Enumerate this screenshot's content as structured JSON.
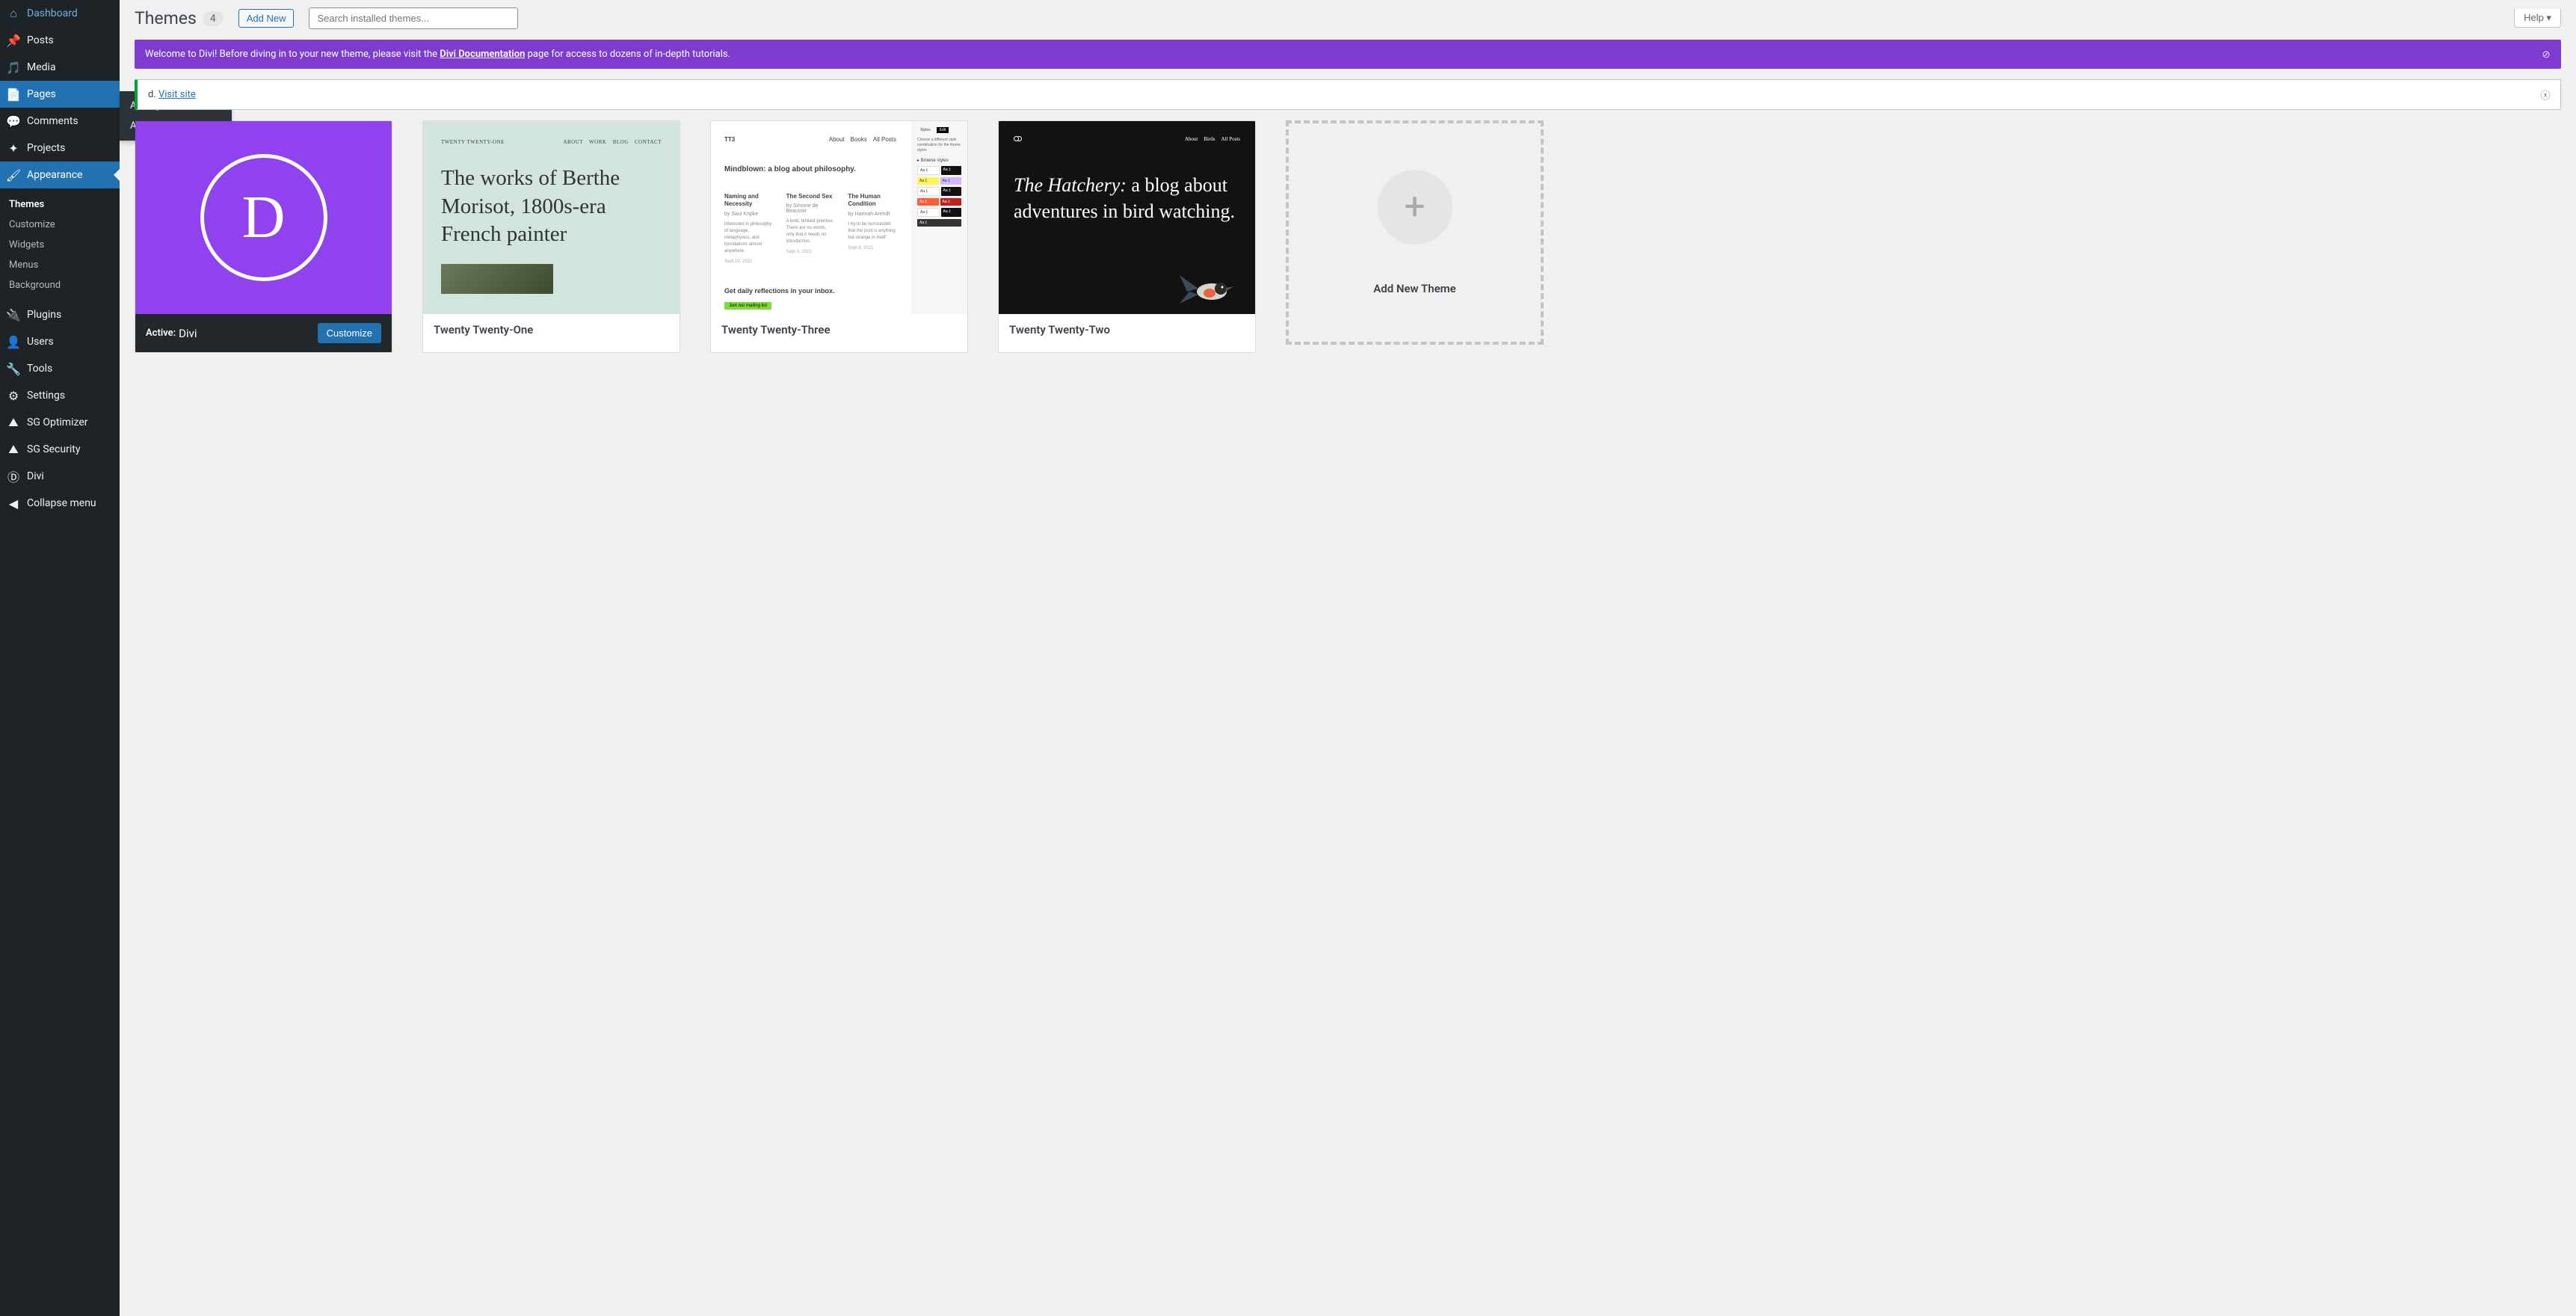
{
  "help_label": "Help ▾",
  "sidebar": {
    "items": [
      {
        "label": "Dashboard",
        "icon": "dashboard"
      },
      {
        "label": "Posts",
        "icon": "pin"
      },
      {
        "label": "Media",
        "icon": "media"
      },
      {
        "label": "Pages",
        "icon": "page",
        "highlighted": true
      },
      {
        "label": "Comments",
        "icon": "comment"
      },
      {
        "label": "Projects",
        "icon": "projects"
      },
      {
        "label": "Appearance",
        "icon": "brush",
        "current": true
      },
      {
        "label": "Plugins",
        "icon": "plug"
      },
      {
        "label": "Users",
        "icon": "user"
      },
      {
        "label": "Tools",
        "icon": "tools"
      },
      {
        "label": "Settings",
        "icon": "settings"
      },
      {
        "label": "SG Optimizer",
        "icon": "sg"
      },
      {
        "label": "SG Security",
        "icon": "sg"
      },
      {
        "label": "Divi",
        "icon": "divi"
      },
      {
        "label": "Collapse menu",
        "icon": "collapse"
      }
    ],
    "pages_flyout": [
      "All Pages",
      "Add New"
    ],
    "appearance_submenu": [
      "Themes",
      "Customize",
      "Widgets",
      "Menus",
      "Background"
    ]
  },
  "header": {
    "title": "Themes",
    "count": "4",
    "add_new": "Add New",
    "search_placeholder": "Search installed themes..."
  },
  "notices": {
    "divi": {
      "pre": "Welcome to Divi! Before diving in to your new theme, please visit the ",
      "link": "Divi Documentation",
      "post": " page for access to dozens of in-depth tutorials."
    },
    "site": {
      "pre_truncated": "d. ",
      "link": "Visit site"
    }
  },
  "themes": [
    {
      "active_label": "Active:",
      "name": "Divi",
      "customize": "Customize"
    },
    {
      "name": "Twenty Twenty-One"
    },
    {
      "name": "Twenty Twenty-Three"
    },
    {
      "name": "Twenty Twenty-Two"
    }
  ],
  "thumb_t21": {
    "brand": "TWENTY TWENTY-ONE",
    "nav": "ABOUT   WORK   BLOG   CONTACT",
    "headline": "The works of Berthe Morisot, 1800s-era French painter"
  },
  "thumb_t23": {
    "brand": "TT3",
    "nav": [
      "About",
      "Books",
      "All Posts"
    ],
    "headline": "Mindblown: a blog about philosophy.",
    "cols": [
      {
        "title": "Naming and Necessity",
        "sub": "by Saul Kripke",
        "txt": "Interested in philosophy of language, metaphysics, and foundations almost anywhere.",
        "date": "Sept 10, 2021"
      },
      {
        "title": "The Second Sex",
        "sub": "by Simone de Beauvoir",
        "txt": "A bold, brilliant premise. There are no words, only that it needs no introduction.",
        "date": "Sept 9, 2021"
      },
      {
        "title": "The Human Condition",
        "sub": "by Hannah Arendt",
        "txt": "I try to be surrounded that the post is anything but strange in itself.",
        "date": "Sept 8, 2021"
      }
    ],
    "bottom_title": "Get daily reflections in your inbox.",
    "bottom_btn": "Join our mailing list",
    "side": {
      "tabs": [
        "Styles",
        "Edit"
      ],
      "caption": "Choose a different style combination for the theme styles",
      "edit_label": "Browse styles",
      "swatch_label": "Aa ‡"
    }
  },
  "thumb_t22": {
    "nav": [
      "About",
      "Birds",
      "All Posts"
    ],
    "head_em": "The Hatchery:",
    "head_rest": " a blog about adventures in bird watching."
  },
  "add_theme_label": "Add New Theme"
}
